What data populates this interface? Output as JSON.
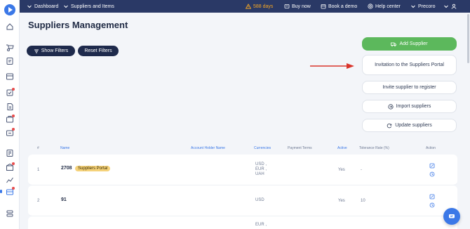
{
  "topbar": {
    "breadcrumb": [
      "Dashboard",
      "Suppliers and Items"
    ],
    "trial_days": "588 days",
    "buy_now": "Buy now",
    "book_demo": "Book a demo",
    "help_center": "Help center",
    "company": "Precoro"
  },
  "page": {
    "title": "Suppliers Management"
  },
  "filters": {
    "show": "Show Filters",
    "reset": "Reset Filters"
  },
  "actions": {
    "add_supplier": "Add Supplier",
    "invite_portal": "Invitation to the Suppliers Portal",
    "invite_register": "Invite supplier to register",
    "import": "Import suppliers",
    "update": "Update suppliers"
  },
  "table": {
    "headers": [
      "#",
      "Name",
      "Account Holder Name",
      "Currencies",
      "Payment Terms",
      "Active",
      "Tolerance Rate (%)",
      "Action"
    ],
    "rows": [
      {
        "num": "1",
        "name": "2708",
        "badge": "Suppliers Portal",
        "currencies": [
          "USD ,",
          "EUR ,",
          "UAH"
        ],
        "active": "Yes",
        "tolerance": "-"
      },
      {
        "num": "2",
        "name": "91",
        "currencies": [
          "USD"
        ],
        "active": "Yes",
        "tolerance": "10"
      },
      {
        "num": "",
        "name": "",
        "currencies": [
          "EUR ,"
        ],
        "active": "",
        "tolerance": ""
      }
    ]
  },
  "colors": {
    "topbar": "#2a3966",
    "accent": "#3b78e7",
    "add_button": "#5cb85c",
    "badge": "#f5d27a",
    "arrow": "#d9342b",
    "warning": "#f5a623"
  }
}
